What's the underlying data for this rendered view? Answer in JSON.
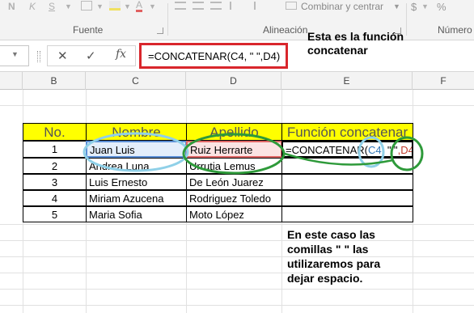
{
  "ribbon": {
    "bold": "N",
    "italic": "K",
    "underline": "S",
    "group_font": "Fuente",
    "group_alignment": "Alineación",
    "merge_label": "Combinar y centrar",
    "group_number": "Número",
    "currency": "$"
  },
  "formula_bar": {
    "formula": "=CONCATENAR(C4, \" \",D4)",
    "cancel": "✕",
    "enter": "✓",
    "fx": "fx"
  },
  "columns": [
    "B",
    "C",
    "D",
    "E",
    "F"
  ],
  "table": {
    "headers": [
      "No.",
      "Nombre",
      "Apellido",
      "Función concatenar"
    ],
    "rows": [
      {
        "no": "1",
        "nombre": "Juan Luis",
        "apellido": "Ruiz Herrarte",
        "funcion": "=CONCATENAR(C4, \" \",D4)"
      },
      {
        "no": "2",
        "nombre": "Andrea Luna",
        "apellido": "Urrutia Lemus",
        "funcion": ""
      },
      {
        "no": "3",
        "nombre": "Luis Ernesto",
        "apellido": "De León Juarez",
        "funcion": ""
      },
      {
        "no": "4",
        "nombre": "Miriam Azucena",
        "apellido": "Rodriguez Toledo",
        "funcion": ""
      },
      {
        "no": "5",
        "nombre": "Maria Sofia",
        "apellido": "Moto López",
        "funcion": ""
      }
    ]
  },
  "formula_parts": {
    "prefix": "=CONCATENAR(",
    "ref1": "C4",
    "mid": ", \" \"",
    "ref2": ",D4",
    "suffix": ")"
  },
  "annotations": {
    "top_line1": "Esta es la función",
    "top_line2": "concatenar",
    "bottom_line1": "En este caso las",
    "bottom_line2": "comillas \" \" las",
    "bottom_line3": "utilizaremos para",
    "bottom_line4": "dejar espacio."
  },
  "colors": {
    "header_fill": "#ffff00",
    "name_highlight": "#e3eefb",
    "surname_highlight": "#fbe3e3",
    "ref_blue": "#2f75b5",
    "ref_red": "#c0392b",
    "formula_box": "#d9262c",
    "circle_blue": "#8fd0e8",
    "circle_green": "#2e9a3a"
  }
}
